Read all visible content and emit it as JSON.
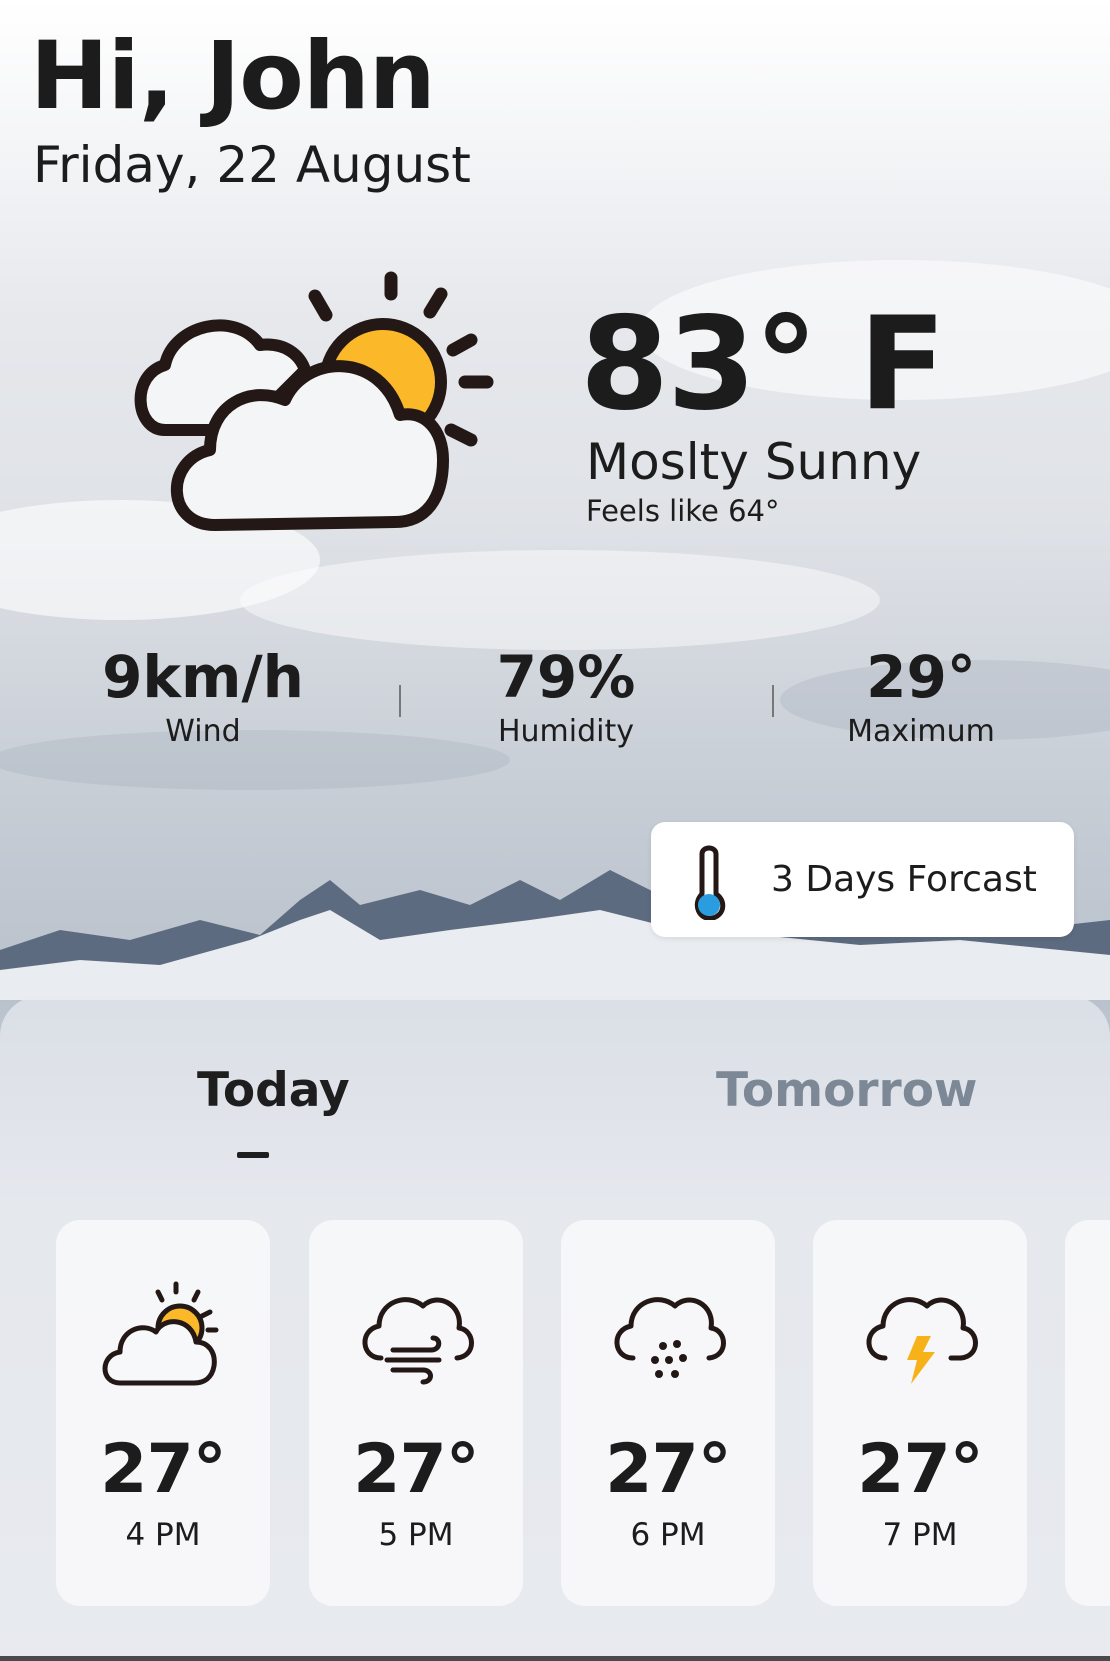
{
  "greeting": "Hi, John",
  "date": "Friday, 22 August",
  "current": {
    "icon": "partly-cloudy-icon",
    "temperature": "83° F",
    "condition": "Moslty Sunny",
    "feels_like": "Feels like 64°"
  },
  "stats": [
    {
      "value": "9km/h",
      "label": "Wind"
    },
    {
      "value": "79%",
      "label": "Humidity"
    },
    {
      "value": "29°",
      "label": "Maximum"
    }
  ],
  "forecast_button": {
    "icon": "thermometer-icon",
    "label": "3 Days Forcast"
  },
  "tabs": [
    {
      "label": "Today",
      "active": true
    },
    {
      "label": "Tomorrow",
      "active": false
    }
  ],
  "hourly": [
    {
      "temp": "27°",
      "time": "4 PM",
      "icon": "partly-cloudy-icon"
    },
    {
      "temp": "27°",
      "time": "5 PM",
      "icon": "windy-cloud-icon"
    },
    {
      "temp": "27°",
      "time": "6 PM",
      "icon": "hail-cloud-icon"
    },
    {
      "temp": "27°",
      "time": "7 PM",
      "icon": "thunderstorm-icon"
    }
  ],
  "colors": {
    "sun": "#FBB829",
    "outline": "#231815",
    "thermometer": "#2A9DE0",
    "tab_inactive": "#7C8896",
    "bolt": "#F7B21A"
  }
}
